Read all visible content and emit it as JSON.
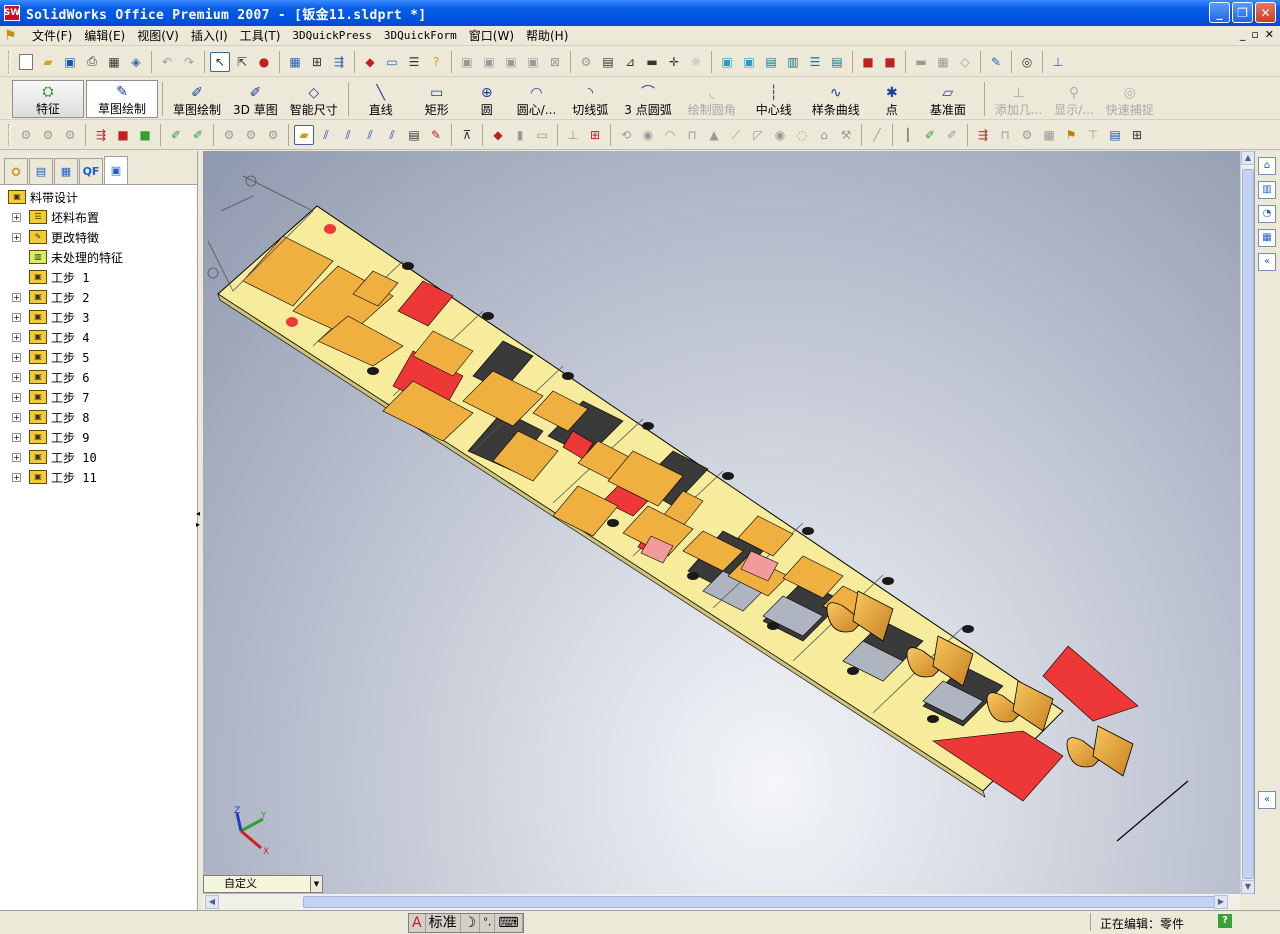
{
  "window": {
    "title": "SolidWorks Office Premium 2007 - [钣金11.sldprt *]",
    "app_icon": "SW",
    "buttons": [
      "_",
      "❐",
      "✕"
    ]
  },
  "menu": {
    "items": [
      "文件(F)",
      "编辑(E)",
      "视图(V)",
      "插入(I)",
      "工具(T)",
      "3DQuickPress",
      "3DQuickForm",
      "窗口(W)",
      "帮助(H)"
    ],
    "doc_controls": [
      "_",
      "▫",
      "✕"
    ]
  },
  "command_manager": {
    "feature_tab": "特征",
    "sketch_tab": "草图绘制",
    "commands": [
      {
        "label": "草图绘制",
        "icon": "sketch-icon",
        "disabled": false
      },
      {
        "label": "3D 草图",
        "icon": "3d-sketch-icon",
        "disabled": false
      },
      {
        "label": "智能尺寸",
        "icon": "smart-dimension-icon",
        "disabled": false
      },
      {
        "label": "直线",
        "icon": "line-icon",
        "disabled": false
      },
      {
        "label": "矩形",
        "icon": "rectangle-icon",
        "disabled": false
      },
      {
        "label": "圆",
        "icon": "circle-icon",
        "disabled": false
      },
      {
        "label": "圆心/...",
        "icon": "center-arc-icon",
        "disabled": false
      },
      {
        "label": "切线弧",
        "icon": "tangent-arc-icon",
        "disabled": false
      },
      {
        "label": "3 点圆弧",
        "icon": "three-point-arc-icon",
        "disabled": false
      },
      {
        "label": "绘制圆角",
        "icon": "fillet-icon",
        "disabled": true
      },
      {
        "label": "中心线",
        "icon": "centerline-icon",
        "disabled": false
      },
      {
        "label": "样条曲线",
        "icon": "spline-icon",
        "disabled": false
      },
      {
        "label": "点",
        "icon": "point-icon",
        "disabled": false
      },
      {
        "label": "基准面",
        "icon": "plane-icon",
        "disabled": false
      },
      {
        "label": "添加几...",
        "icon": "add-relation-icon",
        "disabled": true
      },
      {
        "label": "显示/...",
        "icon": "display-relation-icon",
        "disabled": true
      },
      {
        "label": "快速捕捉",
        "icon": "quick-snap-icon",
        "disabled": true
      }
    ]
  },
  "panel": {
    "tabs": [
      "feature-manager-icon",
      "property-manager-icon",
      "config-manager-icon",
      "QF",
      "strip-layout-icon"
    ],
    "tree": {
      "root": "料带设计",
      "items": [
        {
          "label": "坯料布置",
          "expandable": true
        },
        {
          "label": "更改特徵",
          "expandable": true
        },
        {
          "label": "未处理的特征",
          "expandable": false
        },
        {
          "label": "工步 1",
          "expandable": false
        },
        {
          "label": "工步 2",
          "expandable": true
        },
        {
          "label": "工步 3",
          "expandable": true
        },
        {
          "label": "工步 4",
          "expandable": true
        },
        {
          "label": "工步 5",
          "expandable": true
        },
        {
          "label": "工步 6",
          "expandable": true
        },
        {
          "label": "工步 7",
          "expandable": true
        },
        {
          "label": "工步 8",
          "expandable": true
        },
        {
          "label": "工步 9",
          "expandable": true
        },
        {
          "label": "工步 10",
          "expandable": true
        },
        {
          "label": "工步 11",
          "expandable": true
        }
      ]
    }
  },
  "viewport": {
    "view_orientation": "自定义",
    "triad": {
      "x": "X",
      "y": "Y",
      "z": "Z"
    },
    "colors": {
      "strip": "#f6ec9c",
      "part": "#f0b040",
      "cut": "#ee3838",
      "hole": "#2a2a2a",
      "edge": "#000000"
    }
  },
  "status": {
    "ime": [
      "A",
      "标准",
      "☽",
      "°,",
      "⌨"
    ],
    "editing": "正在编辑：零件",
    "help": "?"
  }
}
